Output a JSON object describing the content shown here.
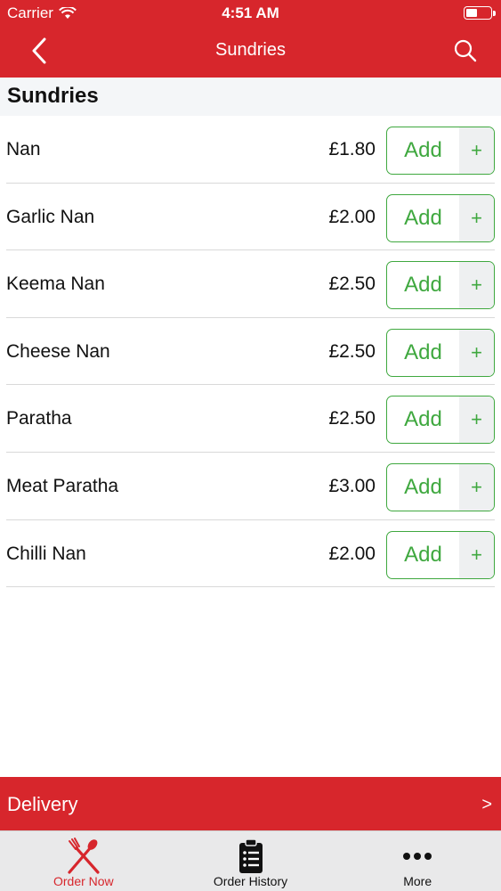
{
  "status_bar": {
    "carrier": "Carrier",
    "time": "4:51 AM"
  },
  "nav": {
    "title": "Sundries",
    "back_icon": "chevron-left-icon",
    "search_icon": "search-icon"
  },
  "section": {
    "title": "Sundries"
  },
  "items": [
    {
      "name": "Nan",
      "price": "£1.80",
      "add_label": "Add",
      "plus_label": "+"
    },
    {
      "name": "Garlic Nan",
      "price": "£2.00",
      "add_label": "Add",
      "plus_label": "+"
    },
    {
      "name": "Keema Nan",
      "price": "£2.50",
      "add_label": "Add",
      "plus_label": "+"
    },
    {
      "name": "Cheese Nan",
      "price": "£2.50",
      "add_label": "Add",
      "plus_label": "+"
    },
    {
      "name": "Paratha",
      "price": "£2.50",
      "add_label": "Add",
      "plus_label": "+"
    },
    {
      "name": "Meat Paratha",
      "price": "£3.00",
      "add_label": "Add",
      "plus_label": "+"
    },
    {
      "name": "Chilli Nan",
      "price": "£2.00",
      "add_label": "Add",
      "plus_label": "+"
    }
  ],
  "delivery": {
    "label": "Delivery",
    "arrow": ">"
  },
  "tabs": [
    {
      "label": "Order Now",
      "icon": "fork-knife-icon",
      "active": true
    },
    {
      "label": "Order History",
      "icon": "clipboard-icon",
      "active": false
    },
    {
      "label": "More",
      "icon": "more-dots-icon",
      "active": false
    }
  ],
  "colors": {
    "brand_red": "#d7262c",
    "add_green": "#3fa83f"
  }
}
